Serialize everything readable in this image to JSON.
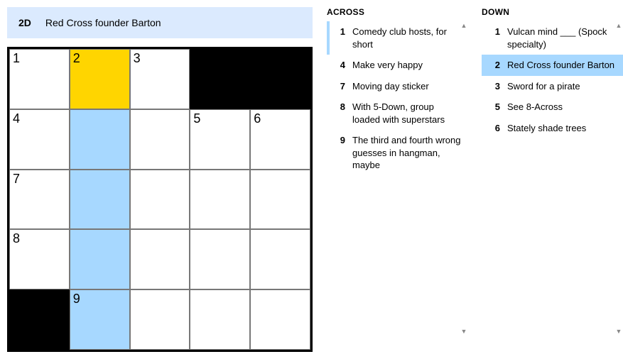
{
  "current_clue": {
    "label": "2D",
    "text": "Red Cross founder Barton"
  },
  "grid": {
    "rows": 5,
    "cols": 5,
    "cells": [
      [
        {
          "num": "1"
        },
        {
          "num": "2",
          "state": "focus"
        },
        {
          "num": "3"
        },
        {
          "black": true
        },
        {
          "black": true
        }
      ],
      [
        {
          "num": "4"
        },
        {
          "state": "hl"
        },
        {},
        {
          "num": "5"
        },
        {
          "num": "6"
        }
      ],
      [
        {
          "num": "7"
        },
        {
          "state": "hl"
        },
        {},
        {},
        {}
      ],
      [
        {
          "num": "8"
        },
        {
          "state": "hl"
        },
        {},
        {},
        {}
      ],
      [
        {
          "black": true
        },
        {
          "num": "9",
          "state": "hl"
        },
        {},
        {},
        {}
      ]
    ]
  },
  "across": {
    "title": "ACROSS",
    "clues": [
      {
        "num": "1",
        "text": "Comedy club hosts, for short",
        "related": true
      },
      {
        "num": "4",
        "text": "Make very happy"
      },
      {
        "num": "7",
        "text": "Moving day sticker"
      },
      {
        "num": "8",
        "text": "With 5-Down, group loaded with superstars"
      },
      {
        "num": "9",
        "text": "The third and fourth wrong guesses in hangman, maybe"
      }
    ]
  },
  "down": {
    "title": "DOWN",
    "clues": [
      {
        "num": "1",
        "text": "Vulcan mind ___ (Spock specialty)"
      },
      {
        "num": "2",
        "text": "Red Cross founder Barton",
        "selected": true
      },
      {
        "num": "3",
        "text": "Sword for a pirate"
      },
      {
        "num": "5",
        "text": "See 8-Across"
      },
      {
        "num": "6",
        "text": "Stately shade trees"
      }
    ]
  }
}
